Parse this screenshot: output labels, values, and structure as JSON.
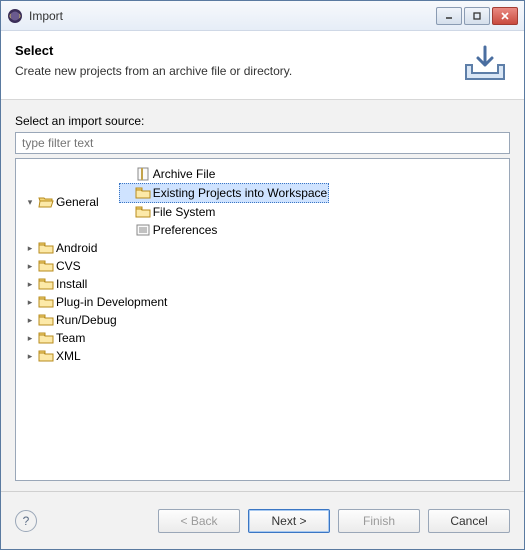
{
  "window": {
    "title": "Import"
  },
  "header": {
    "heading": "Select",
    "subheading": "Create new projects from an archive file or directory."
  },
  "body": {
    "source_label": "Select an import source:",
    "filter_placeholder": "type filter text"
  },
  "tree": {
    "general": {
      "label": "General",
      "children": {
        "archive": "Archive File",
        "existing": "Existing Projects into Workspace",
        "filesystem": "File System",
        "preferences": "Preferences"
      }
    },
    "android": "Android",
    "cvs": "CVS",
    "install": "Install",
    "plugin": "Plug-in Development",
    "rundebug": "Run/Debug",
    "team": "Team",
    "xml": "XML"
  },
  "buttons": {
    "back": "< Back",
    "next": "Next >",
    "finish": "Finish",
    "cancel": "Cancel"
  },
  "selected": "existing"
}
